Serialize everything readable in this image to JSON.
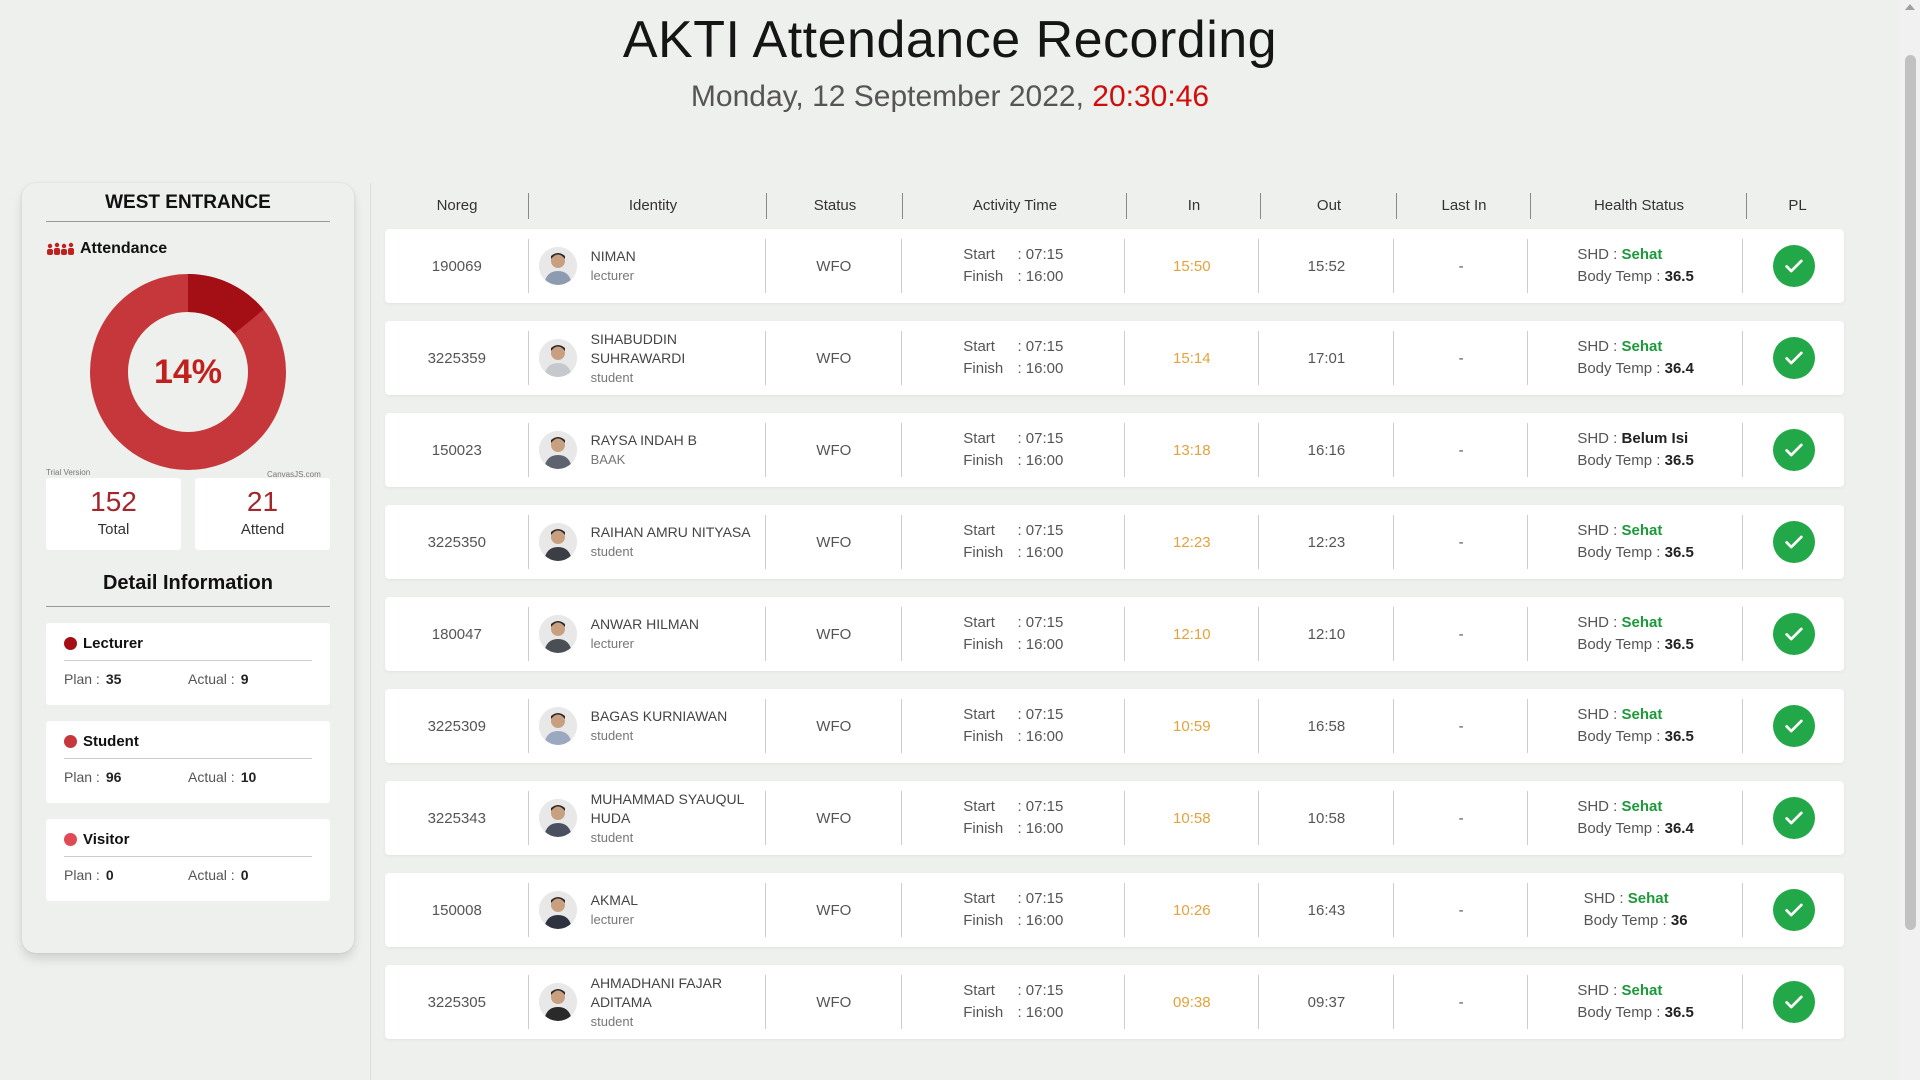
{
  "header": {
    "title": "AKTI Attendance Recording",
    "date": "Monday, 12 September 2022,",
    "time": "20:30:46"
  },
  "sidebar": {
    "title": "WEST ENTRANCE",
    "attendance_label": "Attendance",
    "percent_label": "14%",
    "attend_fraction": 0.14,
    "trial_text": "Trial Version",
    "watermark": "CanvasJS.com",
    "total": {
      "value": "152",
      "label": "Total"
    },
    "attend": {
      "value": "21",
      "label": "Attend"
    },
    "detail_title": "Detail Information",
    "plan_label": "Plan :",
    "actual_label": "Actual :",
    "categories": [
      {
        "name": "Lecturer",
        "plan": "35",
        "actual": "9",
        "color": "#a30f14"
      },
      {
        "name": "Student",
        "plan": "96",
        "actual": "10",
        "color": "#c6373b"
      },
      {
        "name": "Visitor",
        "plan": "0",
        "actual": "0",
        "color": "#e04a55"
      }
    ]
  },
  "table": {
    "headers": [
      "Noreg",
      "Identity",
      "Status",
      "Activity Time",
      "In",
      "Out",
      "Last In",
      "Health Status",
      "PL"
    ],
    "start_label": "Start",
    "finish_label": "Finish",
    "colon": ":",
    "shd_label": "SHD :",
    "temp_label": "Body Temp :",
    "rows": [
      {
        "noreg": "190069",
        "name": "NIMAN",
        "role": "lecturer",
        "status": "WFO",
        "start": "07:15",
        "finish": "16:00",
        "in": "15:50",
        "out": "15:52",
        "last_in": "-",
        "shd": "Sehat",
        "temp": "36.5"
      },
      {
        "noreg": "3225359",
        "name": "SIHABUDDIN SUHRAWARDI",
        "role": "student",
        "status": "WFO",
        "start": "07:15",
        "finish": "16:00",
        "in": "15:14",
        "out": "17:01",
        "last_in": "-",
        "shd": "Sehat",
        "temp": "36.4"
      },
      {
        "noreg": "150023",
        "name": "RAYSA INDAH B",
        "role": "BAAK",
        "status": "WFO",
        "start": "07:15",
        "finish": "16:00",
        "in": "13:18",
        "out": "16:16",
        "last_in": "-",
        "shd": "Belum Isi",
        "temp": "36.5"
      },
      {
        "noreg": "3225350",
        "name": "RAIHAN AMRU NITYASA",
        "role": "student",
        "status": "WFO",
        "start": "07:15",
        "finish": "16:00",
        "in": "12:23",
        "out": "12:23",
        "last_in": "-",
        "shd": "Sehat",
        "temp": "36.5"
      },
      {
        "noreg": "180047",
        "name": "ANWAR HILMAN",
        "role": "lecturer",
        "status": "WFO",
        "start": "07:15",
        "finish": "16:00",
        "in": "12:10",
        "out": "12:10",
        "last_in": "-",
        "shd": "Sehat",
        "temp": "36.5"
      },
      {
        "noreg": "3225309",
        "name": "BAGAS KURNIAWAN",
        "role": "student",
        "status": "WFO",
        "start": "07:15",
        "finish": "16:00",
        "in": "10:59",
        "out": "16:58",
        "last_in": "-",
        "shd": "Sehat",
        "temp": "36.5"
      },
      {
        "noreg": "3225343",
        "name": "MUHAMMAD SYAUQUL HUDA",
        "role": "student",
        "status": "WFO",
        "start": "07:15",
        "finish": "16:00",
        "in": "10:58",
        "out": "10:58",
        "last_in": "-",
        "shd": "Sehat",
        "temp": "36.4"
      },
      {
        "noreg": "150008",
        "name": "AKMAL",
        "role": "lecturer",
        "status": "WFO",
        "start": "07:15",
        "finish": "16:00",
        "in": "10:26",
        "out": "16:43",
        "last_in": "-",
        "shd": "Sehat",
        "temp": "36"
      },
      {
        "noreg": "3225305",
        "name": "AHMADHANI FAJAR ADITAMA",
        "role": "student",
        "status": "WFO",
        "start": "07:15",
        "finish": "16:00",
        "in": "09:38",
        "out": "09:37",
        "last_in": "-",
        "shd": "Sehat",
        "temp": "36.5"
      }
    ]
  },
  "colors": {
    "accent": "#c0201e",
    "in_time": "#e3a23b",
    "healthy": "#1c9a3a",
    "check": "#22a848"
  }
}
